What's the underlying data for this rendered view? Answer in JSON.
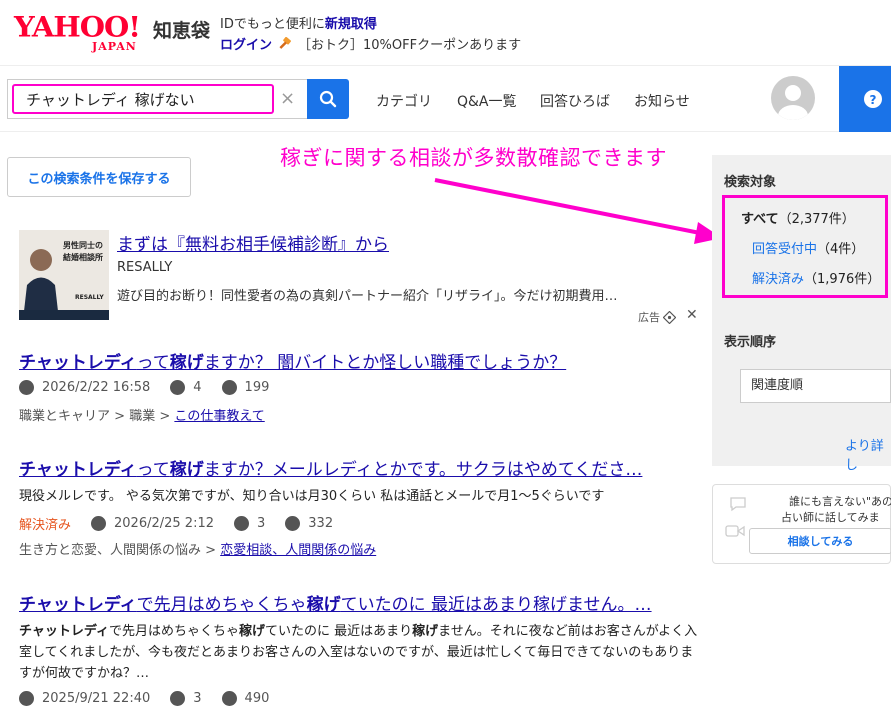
{
  "header": {
    "logo_yahoo": "YAHOO!",
    "logo_japan": "JAPAN",
    "service": "知恵袋",
    "promo_prefix": "IDでもっと便利に",
    "promo_link": "新規取得",
    "login": "ログイン",
    "campaign": "［おトク］10%OFFクーポンあります"
  },
  "search": {
    "query": "チャットレディ 稼げない",
    "clear": "×"
  },
  "nav": [
    "カテゴリ",
    "Q&A一覧",
    "回答ひろば",
    "お知らせ"
  ],
  "save_search": "この検索条件を保存する",
  "annotation": "稼ぎに関する相談が多数散確認できます",
  "ad": {
    "title": "まずは『無料お相手候補診断』から",
    "advertiser": "RESALLY",
    "description": "遊び目的お断り！同性愛者の為の真剣パートナー紹介「リザライ」。今だけ初期費用…",
    "label": "広告",
    "close": "✕",
    "image_text_1": "男性同士の",
    "image_text_2": "結婚相談所",
    "image_brand": "RESALLY"
  },
  "results": [
    {
      "title_parts": [
        {
          "t": "チャットレディ",
          "b": true
        },
        {
          "t": "って",
          "b": false
        },
        {
          "t": "稼げ",
          "b": true
        },
        {
          "t": "ますか？ 闇バイトとか怪しい職種でしょうか？",
          "b": false
        }
      ],
      "status": "",
      "date": "2026/2/22 16:58",
      "answers": "4",
      "views": "199",
      "breadcrumb": [
        "職業とキャリア",
        "職業"
      ],
      "category": "この仕事教えて",
      "snippet": ""
    },
    {
      "title_parts": [
        {
          "t": "チャットレディ",
          "b": true
        },
        {
          "t": "って",
          "b": false
        },
        {
          "t": "稼げ",
          "b": true
        },
        {
          "t": "ますか？メールレディとかです。サクラはやめてくださ…",
          "b": false
        }
      ],
      "status": "解決済み",
      "date": "2026/2/25 2:12",
      "answers": "3",
      "views": "332",
      "breadcrumb": [
        "生き方と恋愛、人間関係の悩み"
      ],
      "category": "恋愛相談、人間関係の悩み",
      "snippet": "現役メルレです。 やる気次第ですが、知り合いは月30くらい 私は通話とメールで月1〜5ぐらいです"
    },
    {
      "title_parts": [
        {
          "t": "チャットレディ",
          "b": true
        },
        {
          "t": "で先月はめちゃくちゃ",
          "b": false
        },
        {
          "t": "稼げ",
          "b": true
        },
        {
          "t": "ていたのに 最近はあまり稼げません。…",
          "b": false
        }
      ],
      "status": "",
      "date": "2025/9/21 22:40",
      "answers": "3",
      "views": "490",
      "breadcrumb": [],
      "category": "",
      "snippet_parts": [
        {
          "t": "チャットレディ",
          "b": true
        },
        {
          "t": "で先月はめちゃくちゃ",
          "b": false
        },
        {
          "t": "稼げ",
          "b": true
        },
        {
          "t": "ていたのに 最近はあまり",
          "b": false
        },
        {
          "t": "稼げ",
          "b": true
        },
        {
          "t": "ません。それに夜など前はお客さんがよく入室してくれましたが、今も夜だとあまりお客さんの入室はないのですが、最近は忙しくて毎日できてないのもありますが何故ですかね？…",
          "b": false
        }
      ]
    }
  ],
  "sidebar": {
    "filter_heading": "検索対象",
    "filters": [
      {
        "label": "すべて",
        "count": "（2,377件）",
        "active": true
      },
      {
        "label": "回答受付中",
        "count": "（4件）",
        "active": false
      },
      {
        "label": "解決済み",
        "count": "（1,976件）",
        "active": false
      }
    ],
    "sort_heading": "表示順序",
    "sort_value": "関連度順",
    "more": "より詳し",
    "card_line1": "誰にも言えない\"あの",
    "card_line2": "占い師に話してみま",
    "card_button": "相談してみる"
  },
  "colors": {
    "accent": "#1a73e8",
    "link": "#1a0dab",
    "highlight": "#ff00cc",
    "solved": "#e6541e",
    "logo": "#ff0033"
  }
}
